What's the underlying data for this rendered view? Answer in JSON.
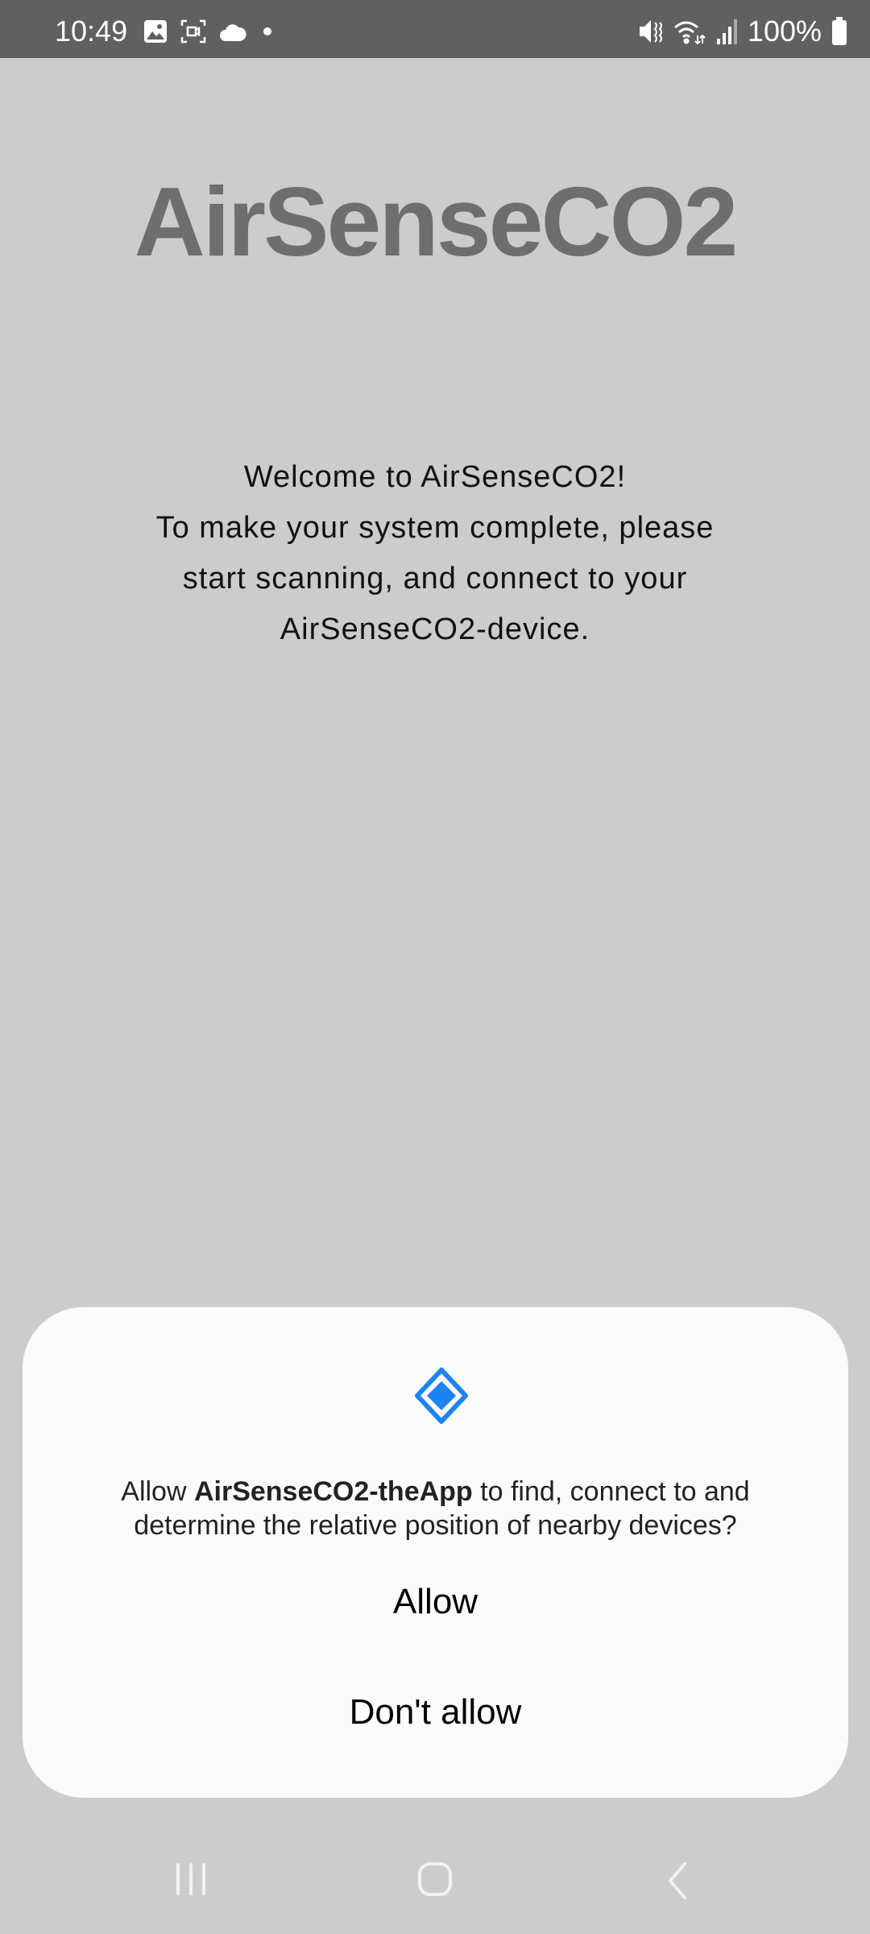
{
  "status_bar": {
    "time": "10:49",
    "left_icons": [
      "gallery-icon",
      "screen-record-icon",
      "cloud-icon",
      "dot-icon"
    ],
    "right_icons": [
      "mute-icon",
      "wifi-icon",
      "signal-icon",
      "battery-icon"
    ],
    "battery": "100%"
  },
  "app": {
    "title": "AirSenseCO2",
    "welcome_lines": [
      "Welcome to AirSenseCO2!",
      "To make your system complete, please",
      "start scanning, and connect to your",
      "AirSenseCO2-device."
    ]
  },
  "dialog": {
    "icon": "nearby-devices-icon",
    "accent": "#1a84f0",
    "message_prefix": "Allow ",
    "app_name": "AirSenseCO2-theApp",
    "message_suffix_line1": " to find, connect to and",
    "message_line2": "determine the relative position of nearby devices?",
    "allow_label": "Allow",
    "deny_label": "Don't allow"
  },
  "nav_bar": {
    "icons": [
      "recents-icon",
      "home-icon",
      "back-icon"
    ]
  }
}
